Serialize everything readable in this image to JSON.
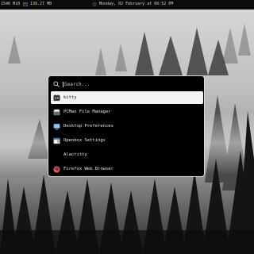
{
  "topbar": {
    "ram": "1546 MiB",
    "disk": "138.27 MB",
    "clock": "Monday, 02 February at 06:52 PM"
  },
  "launcher": {
    "search": {
      "placeholder": "Search...",
      "value": ""
    },
    "items": [
      {
        "label": "kitty",
        "icon": "kitty-icon",
        "selected": true
      },
      {
        "label": "PCMan File Manager",
        "icon": "file-manager-icon",
        "selected": false
      },
      {
        "label": "Desktop Preferences",
        "icon": "desktop-preferences-icon",
        "selected": false
      },
      {
        "label": "Openbox Settings",
        "icon": "openbox-settings-icon",
        "selected": false
      },
      {
        "label": "Alacritty",
        "icon": "alacritty-icon",
        "selected": false
      },
      {
        "label": "Firefox Web Browser",
        "icon": "firefox-icon",
        "selected": false
      }
    ]
  },
  "colors": {
    "bar_bg": "#0b0b0b",
    "accent_disk": "#6b84c7",
    "accent_clock": "#d86a8a",
    "launcher_bg": "#000000",
    "selected_bg": "#f4f4f4"
  }
}
